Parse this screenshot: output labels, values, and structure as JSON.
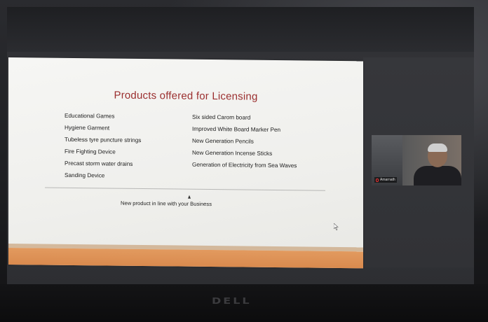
{
  "slide": {
    "title": "Products offered for Licensing",
    "left_items": [
      "Educational Games",
      "Hygiene Garment",
      "Tubeless tyre puncture strings",
      "Fire Fighting Device",
      "Precast storm water drains",
      "Sanding Device"
    ],
    "right_items": [
      "Six sided Carom board",
      "Improved White Board Marker Pen",
      "New Generation Pencils",
      "New Generation Incense Sticks",
      "Generation of Electricity from Sea Waves"
    ],
    "tagline": "New product in line with your Business"
  },
  "video": {
    "participant_name": "Amarnath"
  },
  "device": {
    "brand": "DELL"
  },
  "colors": {
    "title": "#9b2f2f",
    "accent_bar": "#e29a5f"
  },
  "icons": [
    "mic-icon",
    "mouse-pointer-icon"
  ]
}
